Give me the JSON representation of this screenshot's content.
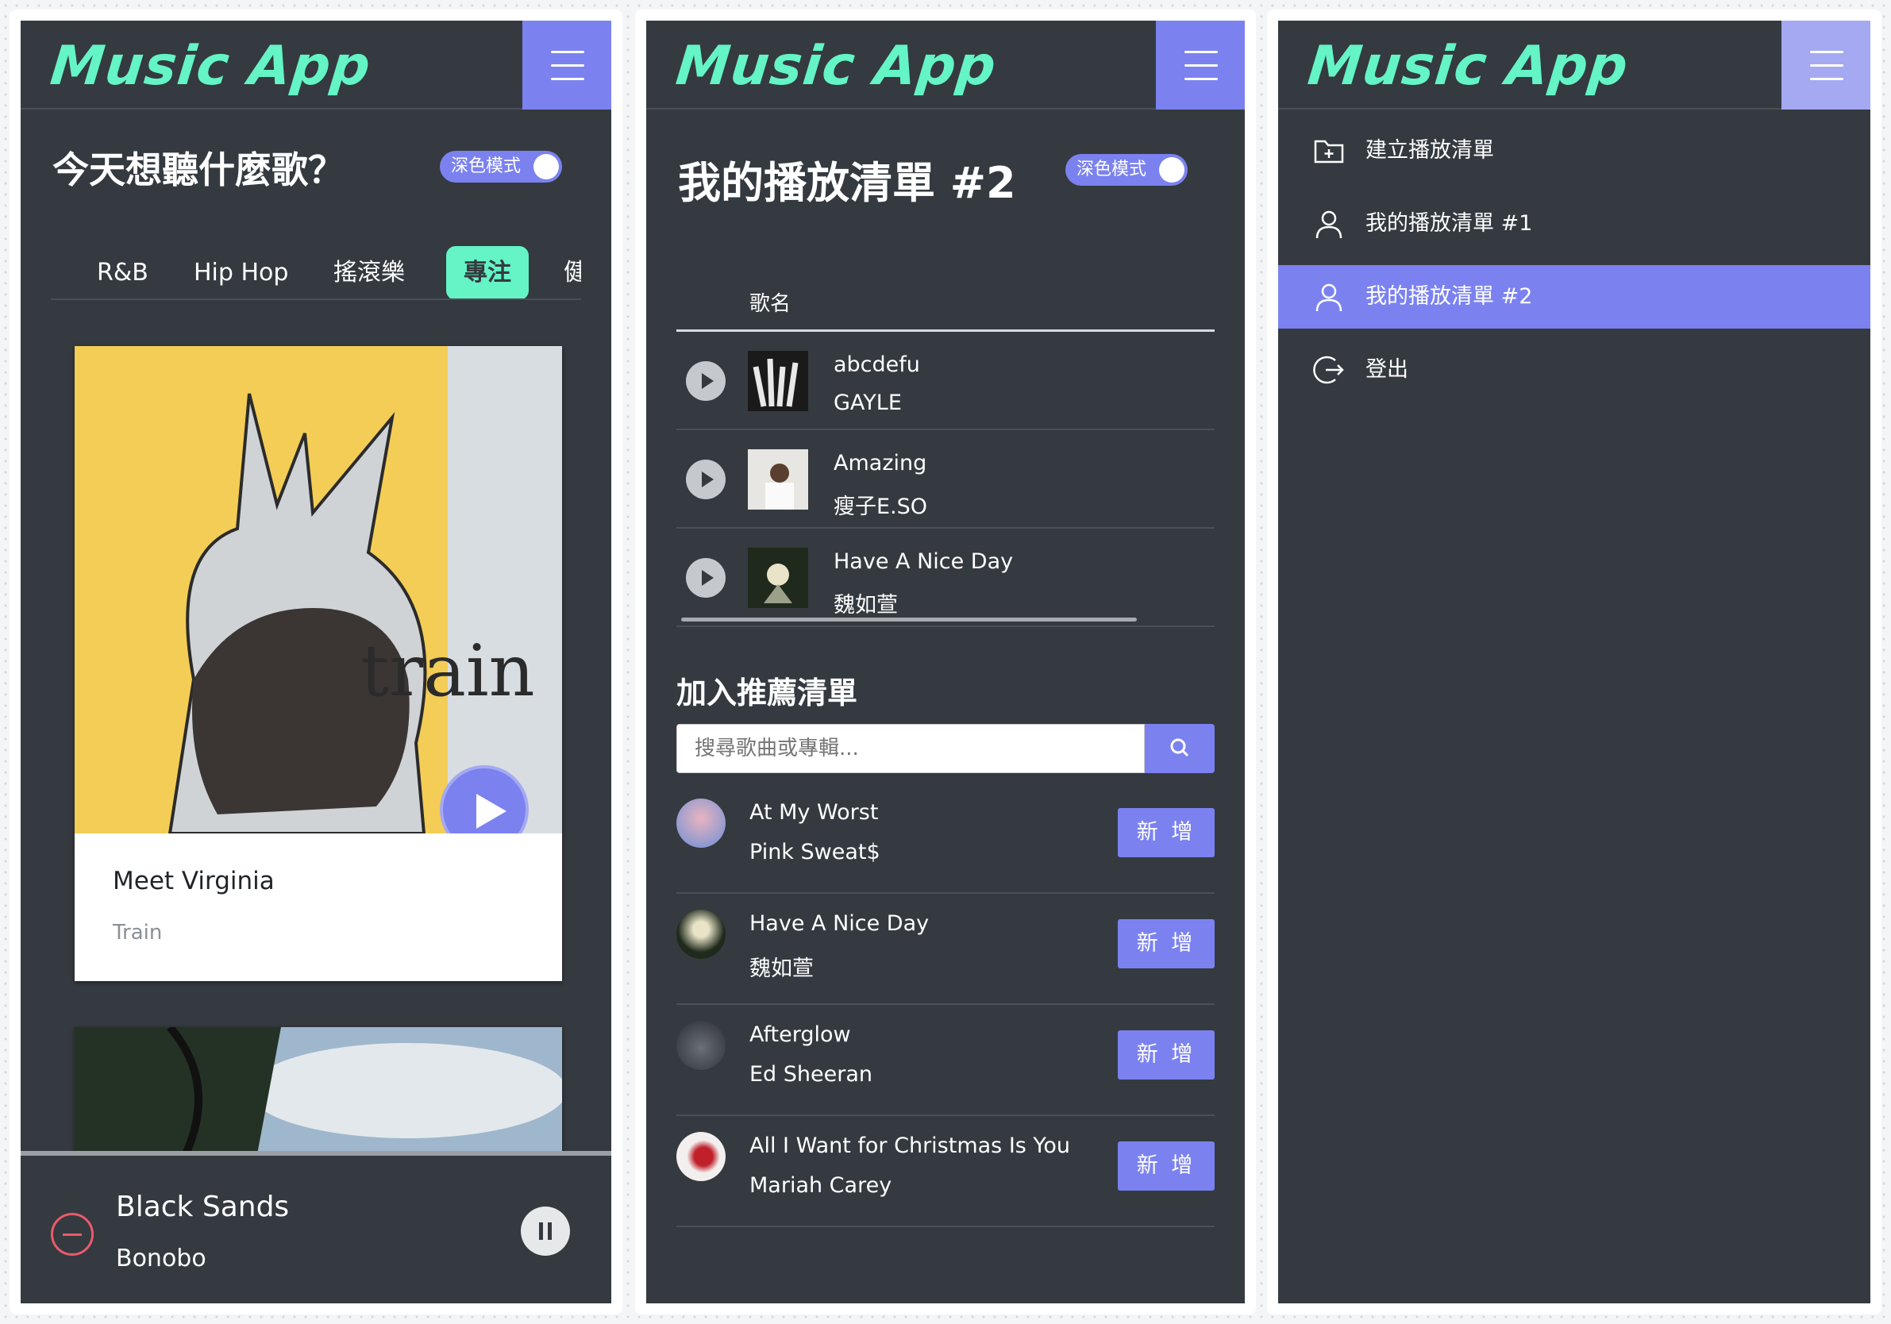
{
  "app": {
    "logo": "Music App"
  },
  "dark_mode": {
    "label": "深色模式"
  },
  "panel_home": {
    "heading": "今天想聽什麼歌？",
    "genres": [
      "R&B",
      "Hip Hop",
      "搖滾樂",
      "專注",
      "健"
    ],
    "active_genre": "專注",
    "featured": {
      "title": "Meet Virginia",
      "artist": "Train",
      "cover_text": "train"
    },
    "now_playing": {
      "title": "Black Sands",
      "artist": "Bonobo"
    }
  },
  "panel_playlist": {
    "heading": "我的播放清單 #2",
    "table_header": "歌名",
    "tracks": [
      {
        "title": "abcdefu",
        "artist": "GAYLE"
      },
      {
        "title": "Amazing",
        "artist": "瘦子E.SO"
      },
      {
        "title": "Have A Nice Day",
        "artist": "魏如萱"
      }
    ],
    "recommend_heading": "加入推薦清單",
    "search_placeholder": "搜尋歌曲或專輯...",
    "add_label": "新 增",
    "recommendations": [
      {
        "title": "At My Worst",
        "artist": "Pink Sweat$"
      },
      {
        "title": "Have A Nice Day",
        "artist": "魏如萱"
      },
      {
        "title": "Afterglow",
        "artist": "Ed Sheeran"
      },
      {
        "title": "All I Want for Christmas Is You",
        "artist": "Mariah Carey"
      }
    ]
  },
  "panel_menu": {
    "items": [
      {
        "label": "建立播放清單",
        "icon": "folder-plus-icon"
      },
      {
        "label": "我的播放清單 #1",
        "icon": "user-icon"
      },
      {
        "label": "我的播放清單 #2",
        "icon": "user-icon"
      },
      {
        "label": "登出",
        "icon": "logout-icon"
      }
    ],
    "active_index": 2
  },
  "colors": {
    "accent": "#7b82ef",
    "brand": "#64f4c6",
    "background": "#343a40"
  }
}
